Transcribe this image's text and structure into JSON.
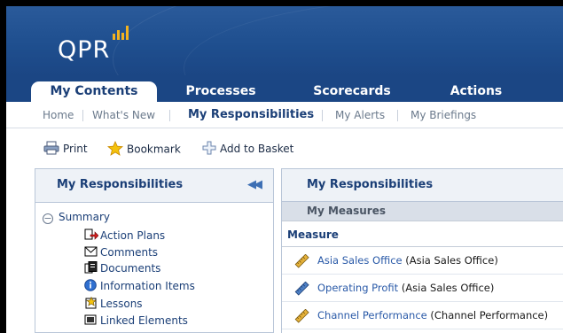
{
  "header": {
    "logo_text": "QPR"
  },
  "tabs": [
    {
      "label": "My Contents",
      "active": true
    },
    {
      "label": "Processes"
    },
    {
      "label": "Scorecards"
    },
    {
      "label": "Actions"
    }
  ],
  "subnav": [
    {
      "label": "Home"
    },
    {
      "label": "What's New"
    },
    {
      "label": "My Responsibilities",
      "active": true
    },
    {
      "label": "My Alerts"
    },
    {
      "label": "My Briefings"
    }
  ],
  "toolbar": {
    "print": "Print",
    "bookmark": "Bookmark",
    "add_to_basket": "Add to Basket"
  },
  "left_panel": {
    "title": "My Responsibilities",
    "collapse_icon": "double-chevron-left-icon",
    "tree": {
      "root": "Summary",
      "items": [
        {
          "label": "Action Plans",
          "icon": "action-plans-icon"
        },
        {
          "label": "Comments",
          "icon": "envelope-icon"
        },
        {
          "label": "Documents",
          "icon": "documents-icon"
        },
        {
          "label": "Information Items",
          "icon": "info-icon"
        },
        {
          "label": "Lessons",
          "icon": "lessons-icon"
        },
        {
          "label": "Linked Elements",
          "icon": "linked-elements-icon"
        }
      ]
    }
  },
  "right_panel": {
    "title": "My Responsibilities",
    "section": "My Measures",
    "column": "Measure",
    "rows": [
      {
        "name": "Asia Sales Office",
        "context": "(Asia Sales Office)",
        "icon_color": "#d9a31a"
      },
      {
        "name": "Operating Profit",
        "context": "(Asia Sales Office)",
        "icon_color": "#3d6fb6"
      },
      {
        "name": "Channel Performance",
        "context": "(Channel Performance)",
        "icon_color": "#d9a31a"
      }
    ]
  },
  "colors": {
    "header_bg": "#1f4f8f",
    "accent": "#f3b21f",
    "text_link": "#2a5aa8"
  }
}
